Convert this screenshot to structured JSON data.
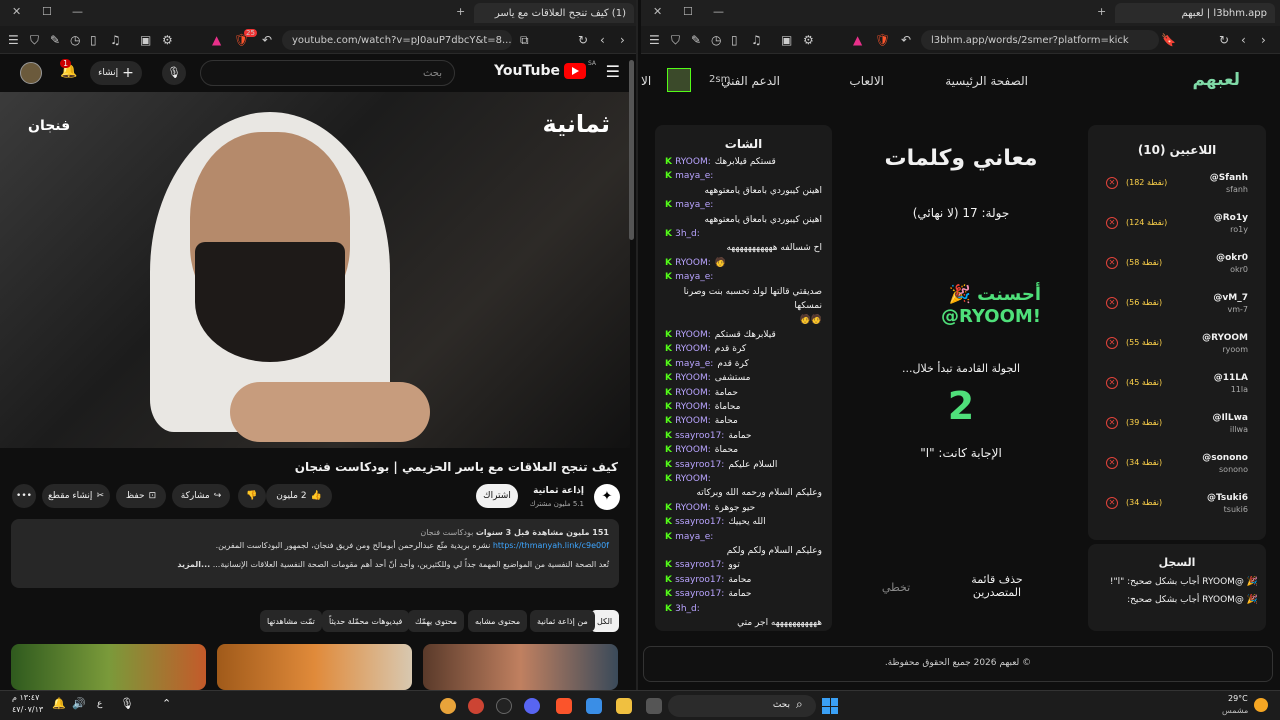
{
  "left_window": {
    "tab_title": "(1) كيف تنجح العلاقات مع ياسر",
    "url": "youtube.com/watch?v=pJ0auP7dbcY&t=8...",
    "badge": "25"
  },
  "youtube": {
    "logo": "YouTube",
    "logo_sup": "SA",
    "search_placeholder": "بحث",
    "create_label": "إنشاء",
    "notif_count": "1",
    "video_overlay_right": "ثمانية",
    "video_overlay_left": "فنجان",
    "video_title": "كيف تنجح العلاقات مع ياسر الحزيمي | بودكاست فنجان",
    "channel": "إذاعة ثمانية",
    "subscribers": "5.1 مليون مشترك",
    "subscribe": "اشتراك",
    "likes": "2 مليون",
    "share": "مشاركة",
    "save": "حفظ",
    "clip": "إنشاء مقطع",
    "desc_meta": "151 مليون مشاهدة قبل 3 سنوات",
    "desc_meta_tag": "بودكاست فنجان",
    "desc_line1": "نشره بريدية متّع عبدالرحمن أبومالح ومن فريق فنجان، لجمهور البودكاست المفرين.",
    "desc_link": "https://thmanyah.link/c9e00f",
    "desc_line2": "تُعد الصحة النفسية من المواضيع المهمة جداً لي وللكثيرين، وأجد أنّ أحد أهم مقومات الصحة النفسية العلاقات الإنسانية...",
    "desc_more": "...المزيد",
    "chips": [
      "الكل",
      "من إذاعة ثمانية",
      "محتوى مشابه",
      "محتوى يهمّك",
      "فيديوهات محمّلة حديثاً",
      "تمّت مشاهدتها"
    ]
  },
  "right_window": {
    "tab_title": "l3bhm.app | لعبهم",
    "url": "l3bhm.app/words/2smer?platform=kick"
  },
  "app": {
    "logo": "لعبهم",
    "nav": [
      "الصفحة الرئيسية",
      "الالعاب",
      "الدعم الفني",
      "الا"
    ],
    "user": "2sm",
    "chat_title": "الشات",
    "chat": [
      {
        "u": "RYOOM:",
        "m": "قستكم قيلابرهك"
      },
      {
        "u": "maya_e:",
        "m": ""
      },
      {
        "u": "",
        "m": "اهينن كيبوردي بامعاق يامعتوههه"
      },
      {
        "u": "maya_e:",
        "m": ""
      },
      {
        "u": "",
        "m": "اهينن كيبوردي بامعاق يامعتوههه"
      },
      {
        "u": "3h_d:",
        "m": ""
      },
      {
        "u": "",
        "m": "اح شسالفه هههههههههههه"
      },
      {
        "u": "RYOOM:",
        "m": "🧑"
      },
      {
        "u": "maya_e:",
        "m": ""
      },
      {
        "u": "",
        "m": "صديقتي قالتها لولد تحسبه بنت وصرنا"
      },
      {
        "u": "",
        "m": "نمسكها"
      },
      {
        "u": "",
        "m": "🧑🧑"
      },
      {
        "u": "RYOOM:",
        "m": "قيلابرهك قستكم"
      },
      {
        "u": "RYOOM:",
        "m": "كرة قدم"
      },
      {
        "u": "maya_e:",
        "m": "كرة قدم"
      },
      {
        "u": "RYOOM:",
        "m": "مستشفى"
      },
      {
        "u": "RYOOM:",
        "m": "حمامة"
      },
      {
        "u": "RYOOM:",
        "m": "محاماة"
      },
      {
        "u": "RYOOM:",
        "m": "محامة"
      },
      {
        "u": "ssayroo17:",
        "m": "حمامة"
      },
      {
        "u": "RYOOM:",
        "m": "محماة"
      },
      {
        "u": "ssayroo17:",
        "m": "السلام عليكم"
      },
      {
        "u": "RYOOM:",
        "m": ""
      },
      {
        "u": "",
        "m": "وعليكم السلام ورحمه الله وبركاته"
      },
      {
        "u": "RYOOM:",
        "m": "حيو جوهرة"
      },
      {
        "u": "ssayroo17:",
        "m": "الله يحييك"
      },
      {
        "u": "maya_e:",
        "m": ""
      },
      {
        "u": "",
        "m": "وعليكم السلام ولكم ولكم"
      },
      {
        "u": "ssayroo17:",
        "m": "توو"
      },
      {
        "u": "ssayroo17:",
        "m": "محامة"
      },
      {
        "u": "ssayroo17:",
        "m": "حمامة"
      },
      {
        "u": "3h_d:",
        "m": ""
      },
      {
        "u": "",
        "m": "هههههههههههه اجر متي"
      }
    ],
    "game_title": "معاني وكلمات",
    "round": "جولة: 17 (لا نهائي)",
    "win_line1": "أحسنت 🎉",
    "win_line2": "@RYOOM!",
    "next_round": "الجولة القادمة تبدأ خلال...",
    "countdown": "2",
    "answer": "الإجابة كانت: \"ا\"",
    "skip": "تخطي",
    "clear_board": "حذف قائمة المتصدرين",
    "players_title": "اللاعبين (10)",
    "players": [
      {
        "name": "@Sfanh",
        "sub": "sfanh",
        "pts": "(182 نقطة)"
      },
      {
        "name": "@Ro1y",
        "sub": "ro1y",
        "pts": "(124 نقطة)"
      },
      {
        "name": "@okr0",
        "sub": "okr0",
        "pts": "(58 نقطة)"
      },
      {
        "name": "@vM_7",
        "sub": "vm-7",
        "pts": "(56 نقطة)"
      },
      {
        "name": "@RYOOM",
        "sub": "ryoom",
        "pts": "(55 نقطة)"
      },
      {
        "name": "@11LA",
        "sub": "11la",
        "pts": "(45 نقطة)"
      },
      {
        "name": "@IlLwa",
        "sub": "illwa",
        "pts": "(39 نقطة)"
      },
      {
        "name": "@sonono",
        "sub": "sonono",
        "pts": "(34 نقطة)"
      },
      {
        "name": "@Tsuki6",
        "sub": "tsuki6",
        "pts": "(34 نقطة)"
      }
    ],
    "log_title": "السجل",
    "log": [
      "🎉 @RYOOM أجاب بشكل صحيح: \"ا\"!",
      "🎉 @RYOOM أجاب بشكل صحيح:"
    ],
    "footer": "© لعبهم 2026 جميع الحقوق محفوظة."
  },
  "taskbar": {
    "search": "بحث",
    "weather_temp": "29°C",
    "weather_desc": "مشمس",
    "time": "١٣:٤٧ م",
    "date": "٤٧/٠٧/١٣",
    "lang": "ع"
  },
  "colors": {
    "kick": "#53fc18",
    "yt_red": "#ff0000",
    "pts": "#ffd34a",
    "error": "#e0433b",
    "win": "#4fe07a"
  }
}
